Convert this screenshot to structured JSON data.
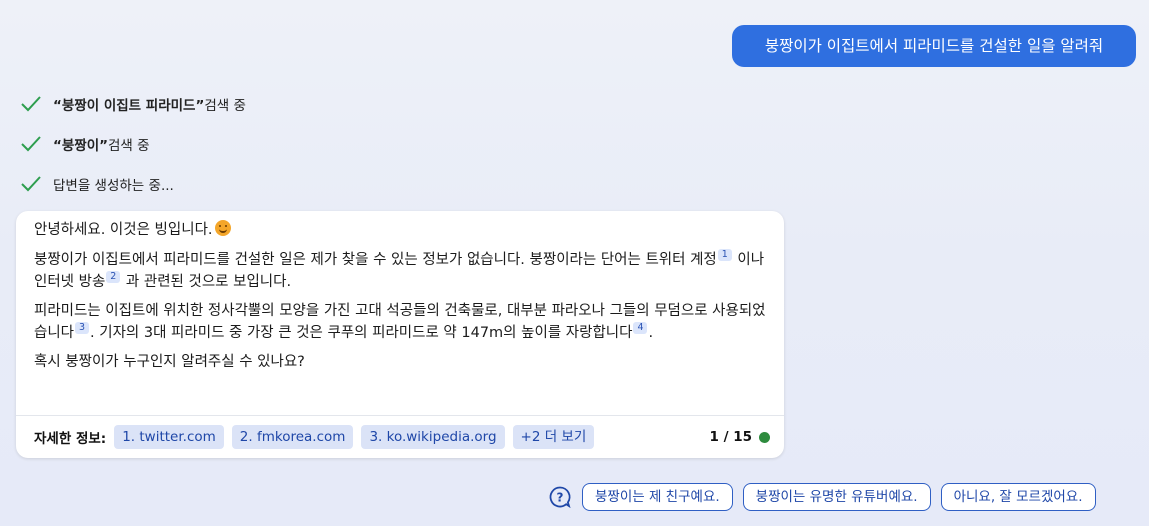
{
  "user_message": "붕짱이가 이집트에서 피라미드를 건설한 일을 알려줘",
  "steps": [
    {
      "bold": "“붕짱이 이집트 피라미드”",
      "text": " 검색 중"
    },
    {
      "bold": "“붕짱이”",
      "text": " 검색 중"
    },
    {
      "bold": "",
      "text": "답변을 생성하는 중..."
    }
  ],
  "answer": {
    "greeting": "안녕하세요. 이것은 빙입니다.",
    "para1_a": "붕짱이가 이집트에서 피라미드를 건설한 일은 제가 찾을 수 있는 정보가 없습니다. 붕짱이라는 단어는 트위터 계정",
    "cite1": "1",
    "para1_b": " 이나 인터넷 방송",
    "cite2": "2",
    "para1_c": " 과 관련된 것으로 보입니다.",
    "para2_a": "피라미드는 이집트에 위치한 정사각뿔의 모양을 가진 고대 석공들의 건축물로, 대부분 파라오나 그들의 무덤으로 사용되었습니다",
    "cite3": "3",
    "para2_b": ". 기자의 3대 피라미드 중 가장 큰 것은 쿠푸의 피라미드로 약 147m의 높이를 자랑합니다",
    "cite4": "4",
    "para2_c": ".",
    "question": "혹시 붕짱이가 누구인지 알려주실 수 있나요?"
  },
  "footer": {
    "label": "자세한 정보:",
    "links": [
      "1. twitter.com",
      "2. fmkorea.com",
      "3. ko.wikipedia.org",
      "+2 더 보기"
    ],
    "count": "1 / 15"
  },
  "suggestions": [
    "붕짱이는 제 친구예요.",
    "붕짱이는 유명한 유튜버예요.",
    "아니요, 잘 모르겠어요."
  ],
  "colors": {
    "accent": "#2f6fe0",
    "check": "#2e9e4f",
    "status_dot": "#2e8b3e"
  },
  "icons": {
    "step": "check-icon",
    "help": "help-circle-icon",
    "emoji": "smiling-face-icon"
  }
}
